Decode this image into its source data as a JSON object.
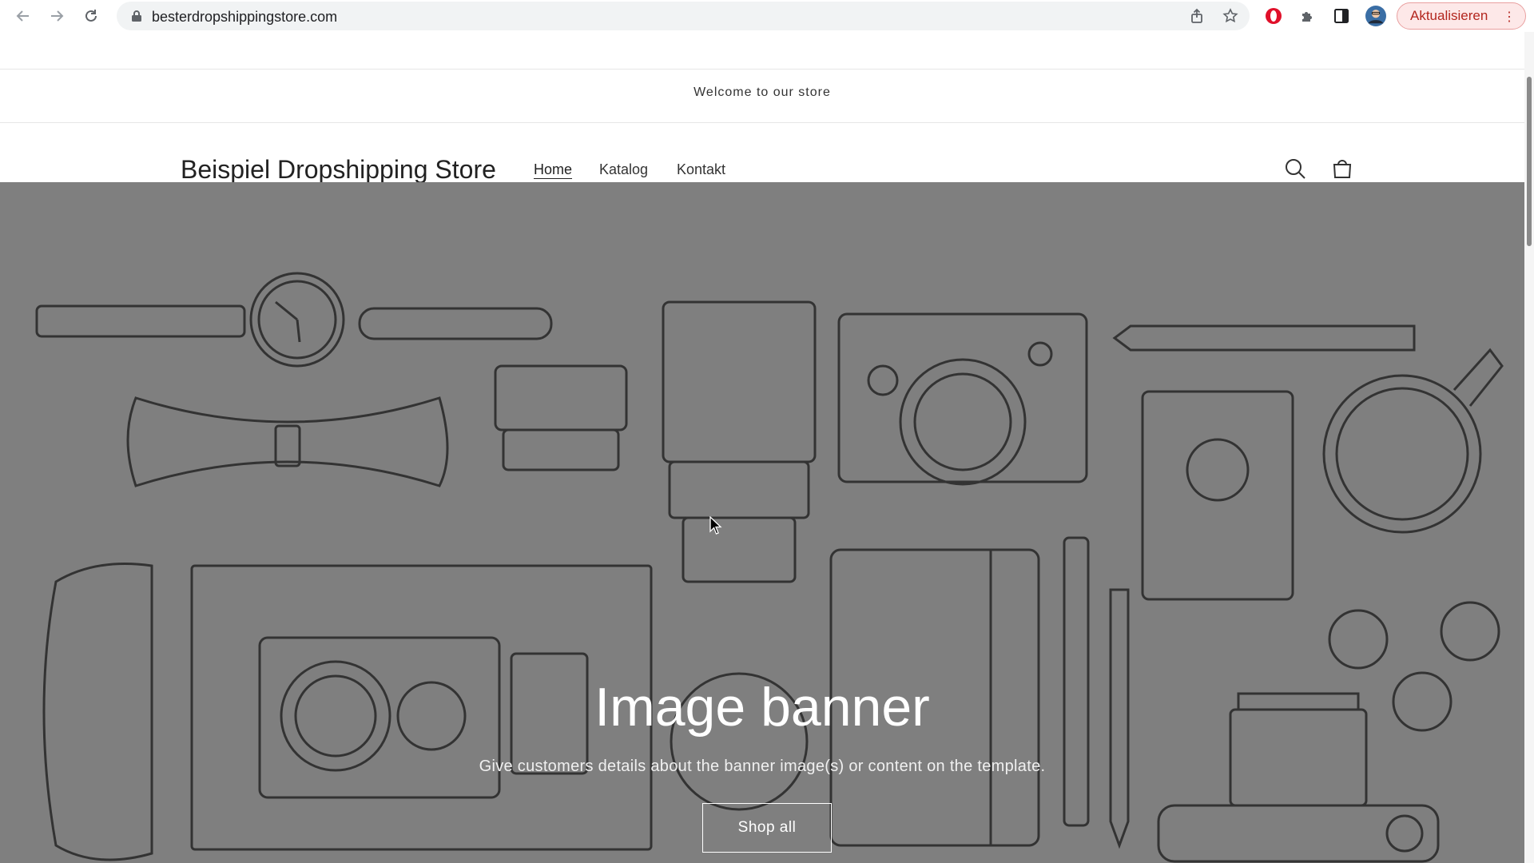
{
  "browser": {
    "url": "besterdropshippingstore.com",
    "update_label": "Aktualisieren"
  },
  "store": {
    "announcement": "Welcome to our store",
    "logo": "Beispiel Dropshipping Store",
    "nav": [
      {
        "label": "Home",
        "active": true
      },
      {
        "label": "Katalog",
        "active": false
      },
      {
        "label": "Kontakt",
        "active": false
      }
    ]
  },
  "banner": {
    "title": "Image banner",
    "subtitle": "Give customers details about the banner image(s) or content on the template.",
    "button_label": "Shop all"
  },
  "colors": {
    "banner_bg": "#7f7f7f",
    "line_art": "#333333",
    "update_accent": "#b3261e"
  },
  "icons": [
    "back-icon",
    "forward-icon",
    "reload-icon",
    "lock-icon",
    "share-icon",
    "star-icon",
    "opera-icon",
    "puzzle-icon",
    "sidebar-icon",
    "avatar",
    "search-icon",
    "cart-icon"
  ]
}
